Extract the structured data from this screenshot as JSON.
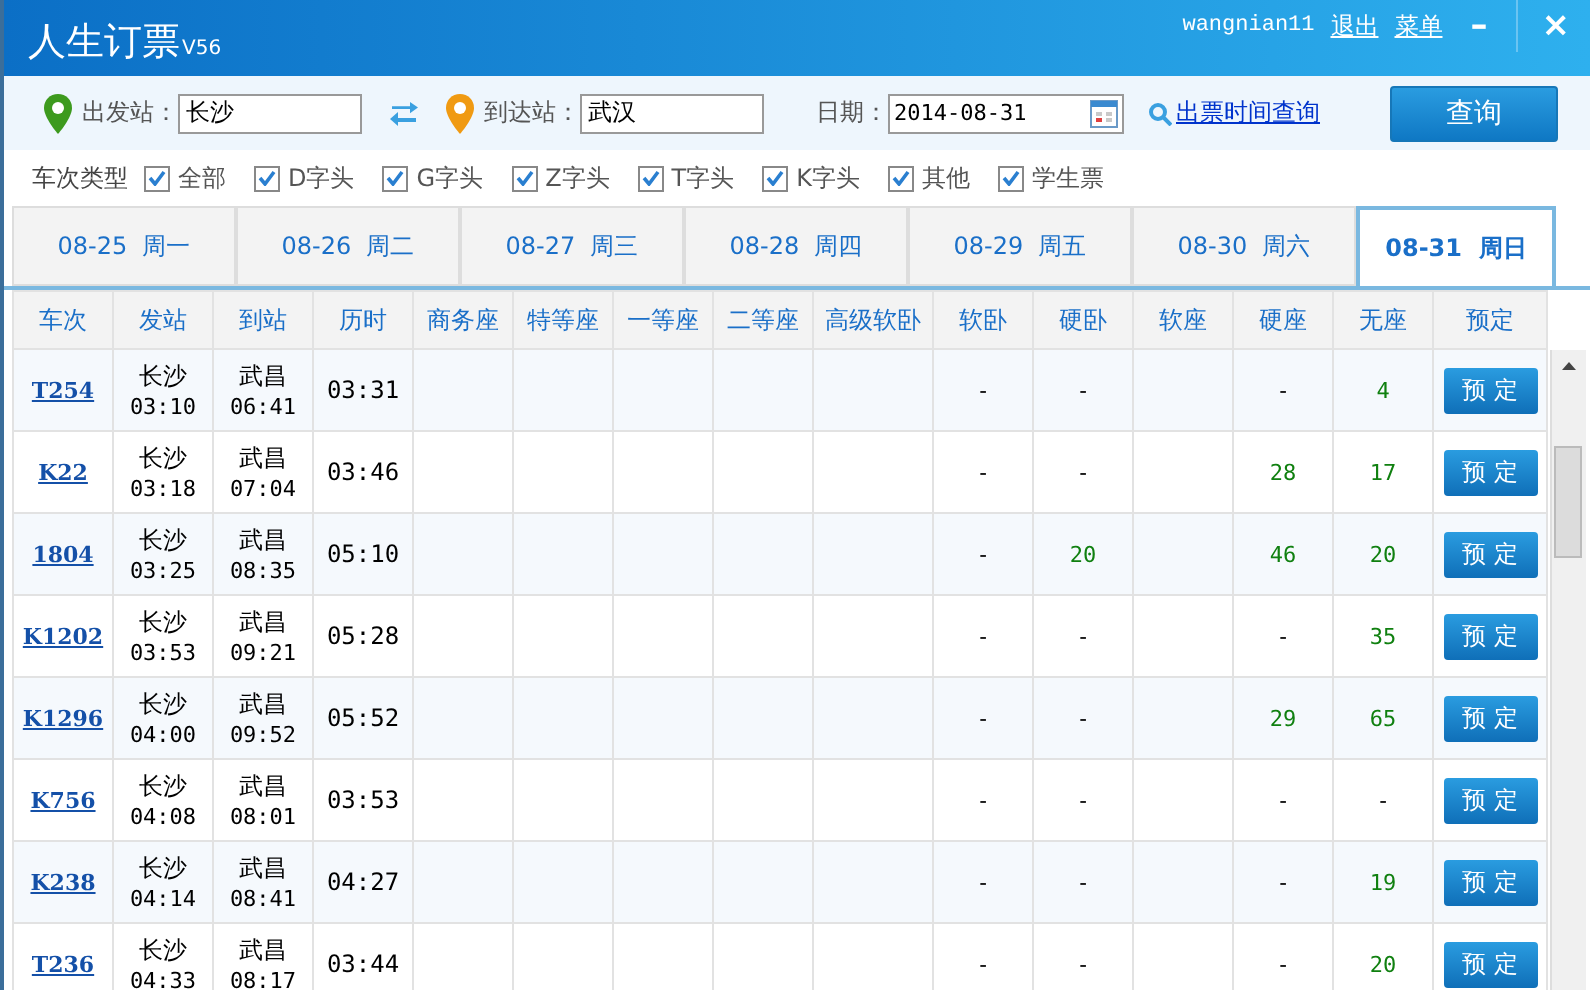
{
  "window": {
    "title": "人生订票",
    "version": "V56",
    "user": "wangnian11",
    "links": [
      "退出",
      "菜单"
    ],
    "minimize": "–",
    "close": "×"
  },
  "search": {
    "from_label": "出发站：",
    "from": "长沙",
    "to_label": "到达站：",
    "to": "武汉",
    "date_label": "日期：",
    "date": "2014-08-31",
    "link": "出票时间查询",
    "button": "查询"
  },
  "filters": {
    "label": "车次类型",
    "items": [
      {
        "label": "全部",
        "checked": true
      },
      {
        "label": "D字头",
        "checked": true
      },
      {
        "label": "G字头",
        "checked": true
      },
      {
        "label": "Z字头",
        "checked": true
      },
      {
        "label": "T字头",
        "checked": true
      },
      {
        "label": "K字头",
        "checked": true
      },
      {
        "label": "其他",
        "checked": true
      },
      {
        "label": "学生票",
        "checked": true
      }
    ]
  },
  "tabs": [
    {
      "date": "08-25",
      "day": "周一",
      "selected": false
    },
    {
      "date": "08-26",
      "day": "周二",
      "selected": false
    },
    {
      "date": "08-27",
      "day": "周三",
      "selected": false
    },
    {
      "date": "08-28",
      "day": "周四",
      "selected": false
    },
    {
      "date": "08-29",
      "day": "周五",
      "selected": false
    },
    {
      "date": "08-30",
      "day": "周六",
      "selected": false
    },
    {
      "date": "08-31",
      "day": "周日",
      "selected": true
    }
  ],
  "table": {
    "columns": [
      "车次",
      "发站",
      "到站",
      "历时",
      "商务座",
      "特等座",
      "一等座",
      "二等座",
      "高级软卧",
      "软卧",
      "硬卧",
      "软座",
      "硬座",
      "无座",
      "预定"
    ],
    "rows": [
      {
        "train": "T254",
        "from": "长沙",
        "dep": "03:10",
        "to": "武昌",
        "arr": "06:41",
        "duration": "03:31",
        "soft_sleeper": {
          "text": "-",
          "available": false
        },
        "hard_sleeper": {
          "text": "-",
          "available": false
        },
        "hard_seat": {
          "text": "-",
          "available": false
        },
        "no_seat": {
          "text": "4",
          "available": true
        },
        "book": "预 定"
      },
      {
        "train": "K22",
        "from": "长沙",
        "dep": "03:18",
        "to": "武昌",
        "arr": "07:04",
        "duration": "03:46",
        "soft_sleeper": {
          "text": "-",
          "available": false
        },
        "hard_sleeper": {
          "text": "-",
          "available": false
        },
        "hard_seat": {
          "text": "28",
          "available": true
        },
        "no_seat": {
          "text": "17",
          "available": true
        },
        "book": "预 定"
      },
      {
        "train": "1804",
        "from": "长沙",
        "dep": "03:25",
        "to": "武昌",
        "arr": "08:35",
        "duration": "05:10",
        "soft_sleeper": {
          "text": "-",
          "available": false
        },
        "hard_sleeper": {
          "text": "20",
          "available": true
        },
        "hard_seat": {
          "text": "46",
          "available": true
        },
        "no_seat": {
          "text": "20",
          "available": true
        },
        "book": "预 定"
      },
      {
        "train": "K1202",
        "from": "长沙",
        "dep": "03:53",
        "to": "武昌",
        "arr": "09:21",
        "duration": "05:28",
        "soft_sleeper": {
          "text": "-",
          "available": false
        },
        "hard_sleeper": {
          "text": "-",
          "available": false
        },
        "hard_seat": {
          "text": "-",
          "available": false
        },
        "no_seat": {
          "text": "35",
          "available": true
        },
        "book": "预 定"
      },
      {
        "train": "K1296",
        "from": "长沙",
        "dep": "04:00",
        "to": "武昌",
        "arr": "09:52",
        "duration": "05:52",
        "soft_sleeper": {
          "text": "-",
          "available": false
        },
        "hard_sleeper": {
          "text": "-",
          "available": false
        },
        "hard_seat": {
          "text": "29",
          "available": true
        },
        "no_seat": {
          "text": "65",
          "available": true
        },
        "book": "预 定"
      },
      {
        "train": "K756",
        "from": "长沙",
        "dep": "04:08",
        "to": "武昌",
        "arr": "08:01",
        "duration": "03:53",
        "soft_sleeper": {
          "text": "-",
          "available": false
        },
        "hard_sleeper": {
          "text": "-",
          "available": false
        },
        "hard_seat": {
          "text": "-",
          "available": false
        },
        "no_seat": {
          "text": "-",
          "available": false
        },
        "book": "预 定"
      },
      {
        "train": "K238",
        "from": "长沙",
        "dep": "04:14",
        "to": "武昌",
        "arr": "08:41",
        "duration": "04:27",
        "soft_sleeper": {
          "text": "-",
          "available": false
        },
        "hard_sleeper": {
          "text": "-",
          "available": false
        },
        "hard_seat": {
          "text": "-",
          "available": false
        },
        "no_seat": {
          "text": "19",
          "available": true
        },
        "book": "预 定"
      },
      {
        "train": "T236",
        "from": "长沙",
        "dep": "04:33",
        "to": "武昌",
        "arr": "08:17",
        "duration": "03:44",
        "soft_sleeper": {
          "text": "-",
          "available": false
        },
        "hard_sleeper": {
          "text": "-",
          "available": false
        },
        "hard_seat": {
          "text": "-",
          "available": false
        },
        "no_seat": {
          "text": "20",
          "available": true
        },
        "book": "预 定"
      }
    ]
  }
}
